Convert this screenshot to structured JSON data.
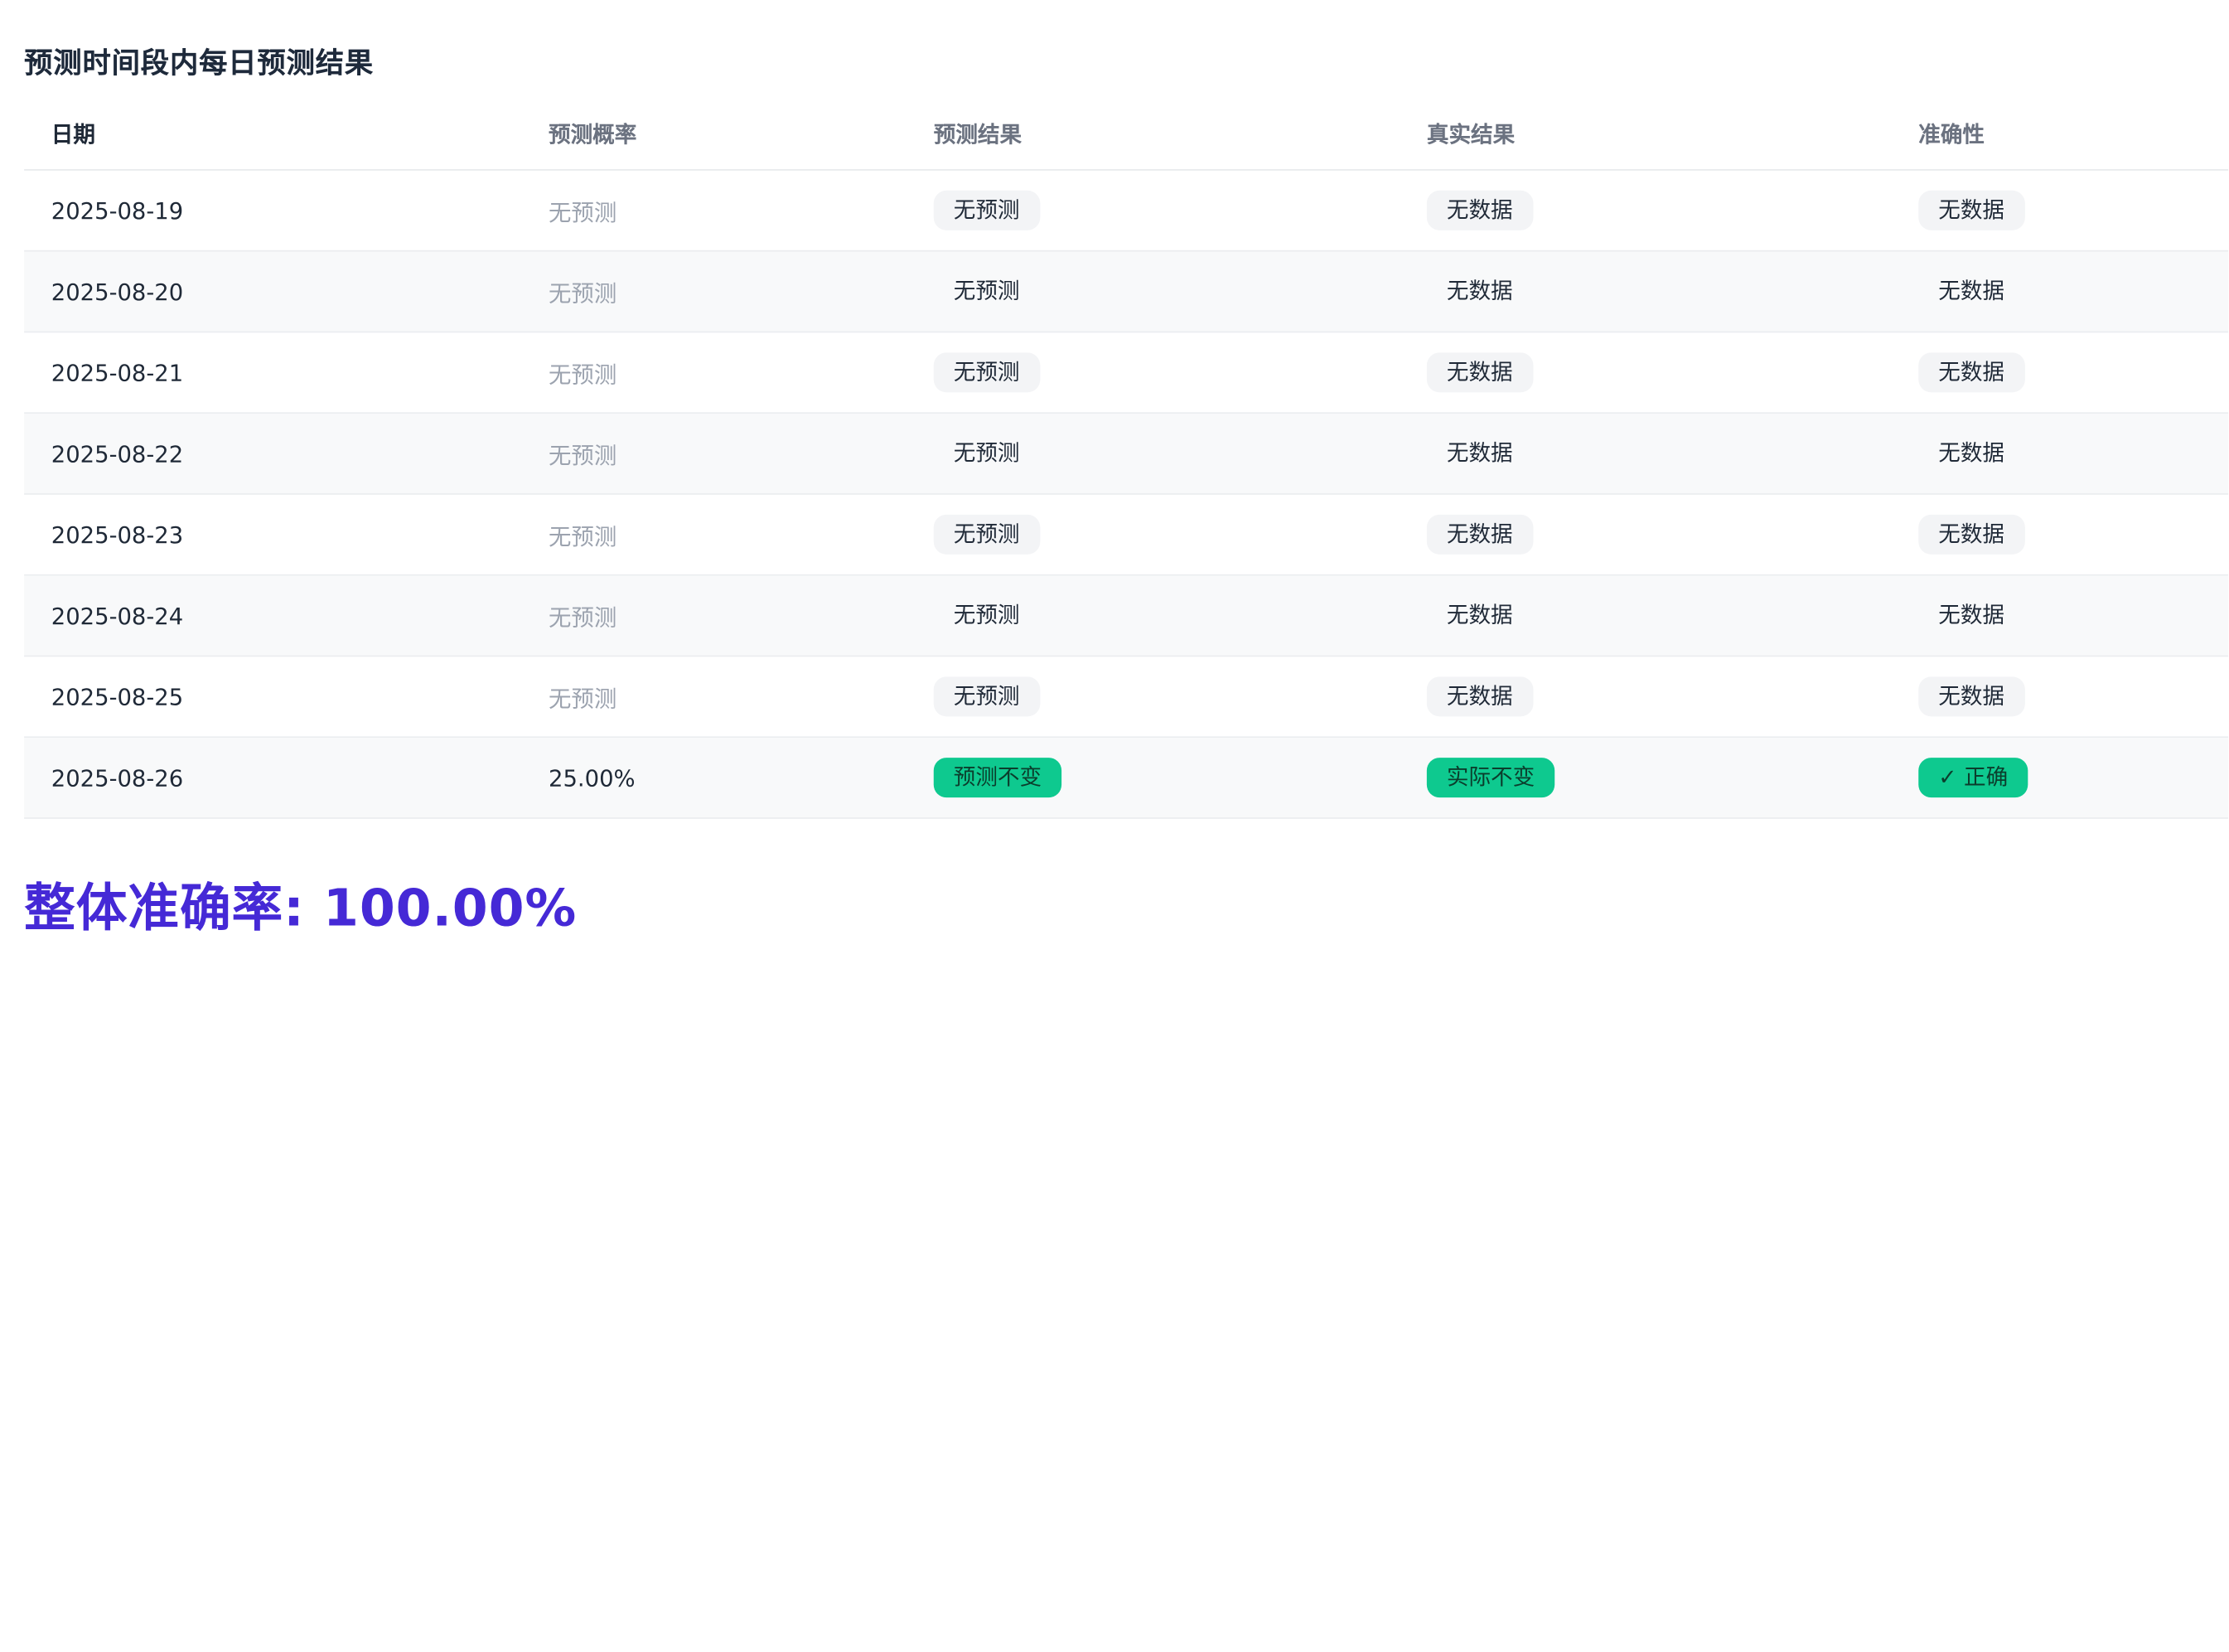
{
  "title": "预测时间段内每日预测结果",
  "headers": {
    "date": "日期",
    "prob": "预测概率",
    "pred": "预测结果",
    "real": "真实结果",
    "acc": "准确性"
  },
  "rows": [
    {
      "date": "2025-08-19",
      "prob": "无预测",
      "pred": "无预测",
      "real": "无数据",
      "acc": "无数据"
    },
    {
      "date": "2025-08-20",
      "prob": "无预测",
      "pred": "无预测",
      "real": "无数据",
      "acc": "无数据"
    },
    {
      "date": "2025-08-21",
      "prob": "无预测",
      "pred": "无预测",
      "real": "无数据",
      "acc": "无数据"
    },
    {
      "date": "2025-08-22",
      "prob": "无预测",
      "pred": "无预测",
      "real": "无数据",
      "acc": "无数据"
    },
    {
      "date": "2025-08-23",
      "prob": "无预测",
      "pred": "无预测",
      "real": "无数据",
      "acc": "无数据"
    },
    {
      "date": "2025-08-24",
      "prob": "无预测",
      "pred": "无预测",
      "real": "无数据",
      "acc": "无数据"
    },
    {
      "date": "2025-08-25",
      "prob": "无预测",
      "pred": "无预测",
      "real": "无数据",
      "acc": "无数据"
    },
    {
      "date": "2025-08-26",
      "prob": "25.00%",
      "pred": "预测不变",
      "real": "实际不变",
      "acc": "✓ 正确"
    }
  ],
  "summary": {
    "accuracy_text": "整体准确率: 100.00%"
  },
  "colors": {
    "accent": "#4529d6",
    "success": "#0ec98f",
    "tag_gray": "#f3f4f6"
  }
}
